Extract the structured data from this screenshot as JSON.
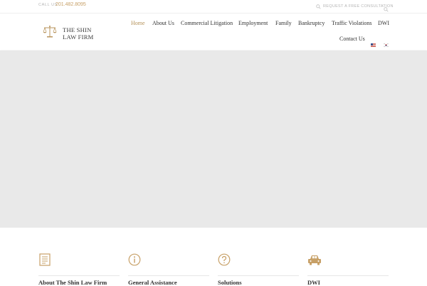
{
  "topbar": {
    "call_label": "CALL US",
    "phone": "201.482.8095",
    "consult_label": "REQUEST A FREE CONSULTATION",
    "icons": [
      "search-icon"
    ]
  },
  "logo": {
    "line1": "THE SHIN",
    "line2": "LAW FIRM",
    "icon": "scales-icon"
  },
  "nav": {
    "items": [
      {
        "label": "Home",
        "active": true
      },
      {
        "label": "About Us"
      },
      {
        "label": "Commercial Litigation"
      },
      {
        "label": "Employment"
      },
      {
        "label": "Family"
      },
      {
        "label": "Bankruptcy"
      },
      {
        "label": "Traffic Violations"
      },
      {
        "label": "DWI"
      },
      {
        "label": "Contact Us"
      }
    ],
    "flags": [
      "us-flag-icon",
      "korea-flag-icon"
    ]
  },
  "features": [
    {
      "icon": "document-icon",
      "title": "About The Shin Law Firm"
    },
    {
      "icon": "info-icon",
      "title": "General Assistance"
    },
    {
      "icon": "question-icon",
      "title": "Solutions"
    },
    {
      "icon": "car-icon",
      "title": "DWI"
    }
  ],
  "colors": {
    "accent": "#c7a067",
    "nav_active": "#b5935a",
    "hero_bg": "#e9e9e9",
    "text": "#333333"
  }
}
